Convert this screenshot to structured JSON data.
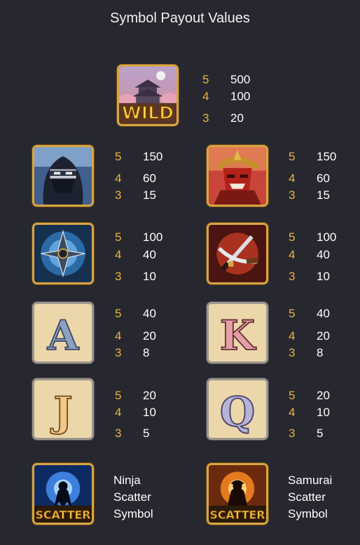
{
  "title": "Symbol Payout Values",
  "symbols": [
    {
      "name": "wild",
      "label": "WILD",
      "payouts": [
        {
          "count": "5",
          "value": "500"
        },
        {
          "count": "4",
          "value": "100"
        },
        {
          "count": "3",
          "value": "20"
        }
      ]
    },
    {
      "name": "ninja",
      "payouts": [
        {
          "count": "5",
          "value": "150"
        },
        {
          "count": "4",
          "value": "60"
        },
        {
          "count": "3",
          "value": "15"
        }
      ]
    },
    {
      "name": "samurai",
      "payouts": [
        {
          "count": "5",
          "value": "150"
        },
        {
          "count": "4",
          "value": "60"
        },
        {
          "count": "3",
          "value": "15"
        }
      ]
    },
    {
      "name": "shuriken",
      "payouts": [
        {
          "count": "5",
          "value": "100"
        },
        {
          "count": "4",
          "value": "40"
        },
        {
          "count": "3",
          "value": "10"
        }
      ]
    },
    {
      "name": "swords",
      "payouts": [
        {
          "count": "5",
          "value": "100"
        },
        {
          "count": "4",
          "value": "40"
        },
        {
          "count": "3",
          "value": "10"
        }
      ]
    },
    {
      "name": "A",
      "letter": "A",
      "payouts": [
        {
          "count": "5",
          "value": "40"
        },
        {
          "count": "4",
          "value": "20"
        },
        {
          "count": "3",
          "value": "8"
        }
      ]
    },
    {
      "name": "K",
      "letter": "K",
      "payouts": [
        {
          "count": "5",
          "value": "40"
        },
        {
          "count": "4",
          "value": "20"
        },
        {
          "count": "3",
          "value": "8"
        }
      ]
    },
    {
      "name": "J",
      "letter": "J",
      "payouts": [
        {
          "count": "5",
          "value": "20"
        },
        {
          "count": "4",
          "value": "10"
        },
        {
          "count": "3",
          "value": "5"
        }
      ]
    },
    {
      "name": "Q",
      "letter": "Q",
      "payouts": [
        {
          "count": "5",
          "value": "20"
        },
        {
          "count": "4",
          "value": "10"
        },
        {
          "count": "3",
          "value": "5"
        }
      ]
    }
  ],
  "scatters": [
    {
      "name": "ninja-scatter",
      "label": "SCATTER",
      "description": [
        "Ninja",
        "Scatter",
        "Symbol"
      ]
    },
    {
      "name": "samurai-scatter",
      "label": "SCATTER",
      "description": [
        "Samurai",
        "Scatter",
        "Symbol"
      ]
    }
  ],
  "colors": {
    "background": "#272730",
    "count": "#e7b63b",
    "value": "#ffffff",
    "frame_gold": "#d6a545",
    "frame_stone": "#9c9690"
  }
}
